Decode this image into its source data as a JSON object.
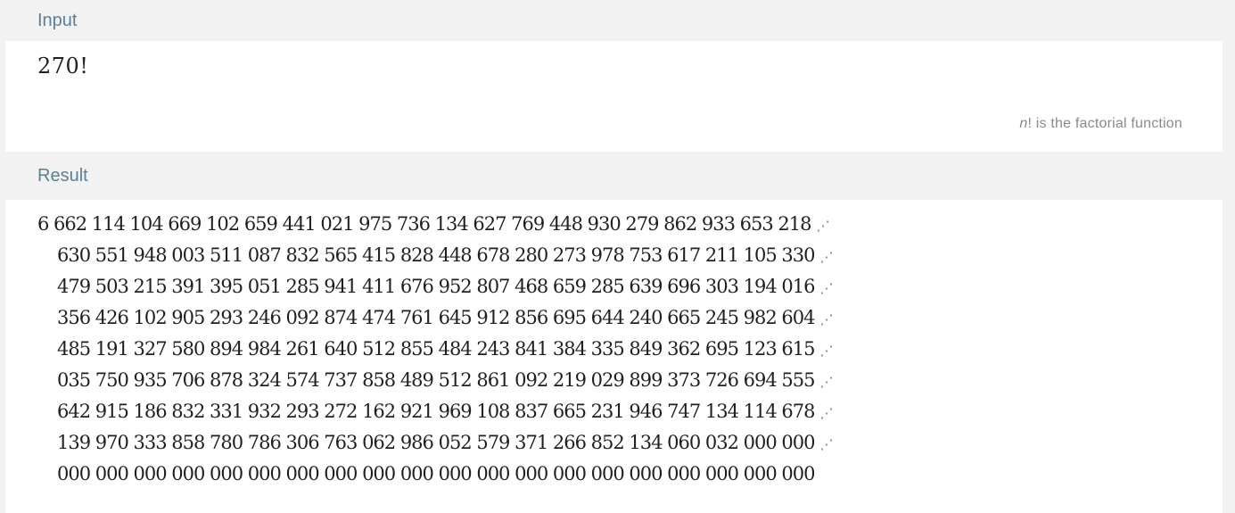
{
  "input_pod": {
    "title": "Input",
    "expression": "270!",
    "note_var": "n",
    "note_rest": "! is the factorial function"
  },
  "result_pod": {
    "title": "Result",
    "continuation_mark": "⋰",
    "lines": [
      "6 662 114 104 669 102 659 441 021 975 736 134 627 769 448 930 279 862 933 653 218",
      "630 551 948 003 511 087 832 565 415 828 448 678 280 273 978 753 617 211 105 330",
      "479 503 215 391 395 051 285 941 411 676 952 807 468 659 285 639 696 303 194 016",
      "356 426 102 905 293 246 092 874 474 761 645 912 856 695 644 240 665 245 982 604",
      "485 191 327 580 894 984 261 640 512 855 484 243 841 384 335 849 362 695 123 615",
      "035 750 935 706 878 324 574 737 858 489 512 861 092 219 029 899 373 726 694 555",
      "642 915 186 832 331 932 293 272 162 921 969 108 837 665 231 946 747 134 114 678",
      "139 970 333 858 780 786 306 763 062 986 052 579 371 266 852 134 060 032 000 000",
      "000 000 000 000 000 000 000 000 000 000 000 000 000 000 000 000 000 000 000 000"
    ]
  }
}
